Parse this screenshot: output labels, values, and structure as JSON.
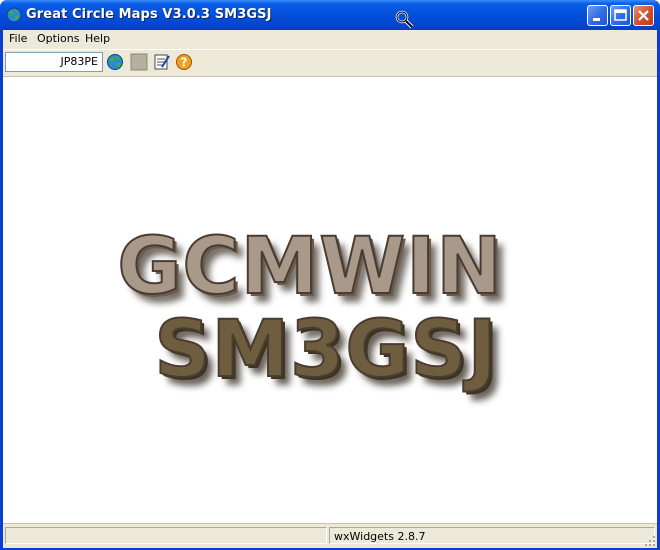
{
  "window": {
    "title": "Great Circle Maps V3.0.3 SM3GSJ",
    "app_icon": "globe-icon",
    "controls": [
      "minimize-icon",
      "maximize-icon",
      "close-icon"
    ],
    "titlebar_color": "#0550dc"
  },
  "menu": {
    "items": [
      {
        "label": "File"
      },
      {
        "label": "Options"
      },
      {
        "label": "Help"
      }
    ]
  },
  "toolbar": {
    "locator_value": "JP83PE",
    "buttons": [
      "globe-icon",
      "blank-icon",
      "edit-icon",
      "help-icon"
    ]
  },
  "splash": {
    "line1": "GCMWIN",
    "line2": "SM3GSJ",
    "color_line1": "#a8998a",
    "color_line2": "#6e5d3e"
  },
  "statusbar": {
    "pane1_text": "",
    "pane2_text": "wxWidgets 2.8.7"
  }
}
